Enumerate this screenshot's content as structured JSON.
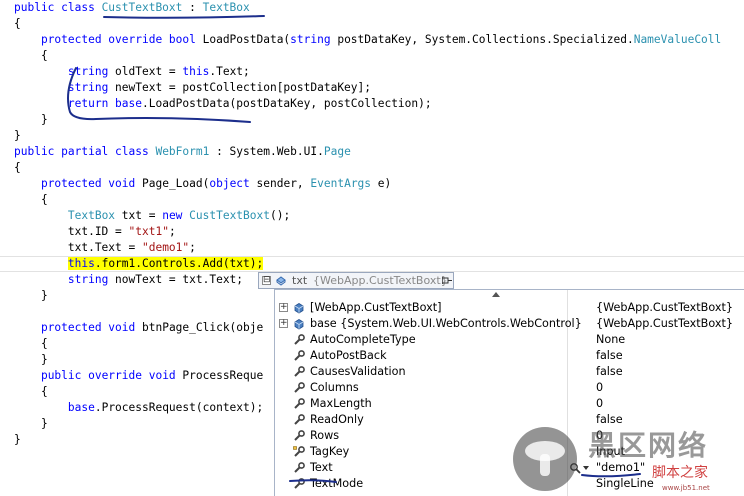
{
  "code": {
    "l1": [
      {
        "t": "public class ",
        "c": "kw"
      },
      {
        "t": "CustTextBoxt",
        "c": "ty"
      },
      {
        "t": " : ",
        "c": "pl"
      },
      {
        "t": "TextBox",
        "c": "ty"
      }
    ],
    "l2": [
      {
        "t": "{",
        "c": "pl"
      }
    ],
    "l3": [
      {
        "t": "    ",
        "c": "pl"
      },
      {
        "t": "protected override bool ",
        "c": "kw"
      },
      {
        "t": "LoadPostData(",
        "c": "pl"
      },
      {
        "t": "string ",
        "c": "kw"
      },
      {
        "t": "postDataKey, System.Collections.Specialized.",
        "c": "pl"
      },
      {
        "t": "NameValueColl",
        "c": "ty"
      }
    ],
    "l4": [
      {
        "t": "    {",
        "c": "pl"
      }
    ],
    "l5": [
      {
        "t": "        ",
        "c": "pl"
      },
      {
        "t": "string ",
        "c": "kw"
      },
      {
        "t": "oldText = ",
        "c": "pl"
      },
      {
        "t": "this",
        "c": "kw"
      },
      {
        "t": ".Text;",
        "c": "pl"
      }
    ],
    "l6": [
      {
        "t": "        ",
        "c": "pl"
      },
      {
        "t": "string ",
        "c": "kw"
      },
      {
        "t": "newText = postCollection[postDataKey];",
        "c": "pl"
      }
    ],
    "l7": [
      {
        "t": "        ",
        "c": "pl"
      },
      {
        "t": "return base",
        "c": "kw"
      },
      {
        "t": ".LoadPostData(postDataKey, postCollection);",
        "c": "pl"
      }
    ],
    "l8": [
      {
        "t": "    }",
        "c": "pl"
      }
    ],
    "l9": [
      {
        "t": "}",
        "c": "pl"
      }
    ],
    "l10": [
      {
        "t": "public partial class ",
        "c": "kw"
      },
      {
        "t": "WebForm1",
        "c": "ty"
      },
      {
        "t": " : System.Web.UI.",
        "c": "pl"
      },
      {
        "t": "Page",
        "c": "ty"
      }
    ],
    "l11": [
      {
        "t": "{",
        "c": "pl"
      }
    ],
    "l12": [
      {
        "t": "    ",
        "c": "pl"
      },
      {
        "t": "protected void ",
        "c": "kw"
      },
      {
        "t": "Page_Load(",
        "c": "pl"
      },
      {
        "t": "object ",
        "c": "kw"
      },
      {
        "t": "sender, ",
        "c": "pl"
      },
      {
        "t": "EventArgs",
        "c": "ty"
      },
      {
        "t": " e)",
        "c": "pl"
      }
    ],
    "l13": [
      {
        "t": "    {",
        "c": "pl"
      }
    ],
    "l14": [
      {
        "t": "        ",
        "c": "pl"
      },
      {
        "t": "TextBox",
        "c": "ty"
      },
      {
        "t": " txt = ",
        "c": "pl"
      },
      {
        "t": "new ",
        "c": "kw"
      },
      {
        "t": "CustTextBoxt",
        "c": "ty"
      },
      {
        "t": "();",
        "c": "pl"
      }
    ],
    "l15": [
      {
        "t": "        txt.ID = ",
        "c": "pl"
      },
      {
        "t": "\"txt1\"",
        "c": "st"
      },
      {
        "t": ";",
        "c": "pl"
      }
    ],
    "l16": [
      {
        "t": "        txt.Text = ",
        "c": "pl"
      },
      {
        "t": "\"demo1\"",
        "c": "st"
      },
      {
        "t": ";",
        "c": "pl"
      }
    ],
    "l17": [
      {
        "t": "        ",
        "c": "pl"
      },
      {
        "t": "this",
        "c": "kw hl-text"
      },
      {
        "t": ".form1.Controls.Add(txt);",
        "c": "pl hl-text"
      }
    ],
    "l18": [
      {
        "t": "        ",
        "c": "pl"
      },
      {
        "t": "string ",
        "c": "kw"
      },
      {
        "t": "nowText = txt.Text;",
        "c": "pl"
      }
    ],
    "l19": [
      {
        "t": "    }",
        "c": "pl"
      }
    ],
    "l20": [
      {
        "t": "",
        "c": "pl"
      }
    ],
    "l21": [
      {
        "t": "    ",
        "c": "pl"
      },
      {
        "t": "protected void ",
        "c": "kw"
      },
      {
        "t": "btnPage_Click(obje",
        "c": "pl"
      }
    ],
    "l22": [
      {
        "t": "    {",
        "c": "pl"
      }
    ],
    "l23": [
      {
        "t": "    }",
        "c": "pl"
      }
    ],
    "l24": [
      {
        "t": "    ",
        "c": "pl"
      },
      {
        "t": "public override void ",
        "c": "kw"
      },
      {
        "t": "ProcessReque",
        "c": "pl"
      }
    ],
    "l25": [
      {
        "t": "    {",
        "c": "pl"
      }
    ],
    "l26": [
      {
        "t": "        ",
        "c": "pl"
      },
      {
        "t": "base",
        "c": "kw"
      },
      {
        "t": ".ProcessRequest(context);",
        "c": "pl"
      }
    ],
    "l27": [
      {
        "t": "    }",
        "c": "pl"
      }
    ],
    "l28": [
      {
        "t": "}",
        "c": "pl"
      }
    ]
  },
  "datatip": {
    "expander": "⊟",
    "name": "txt",
    "value": "{WebApp.CustTextBoxt}"
  },
  "properties": [
    {
      "name": "[WebApp.CustTextBoxt]",
      "value": "{WebApp.CustTextBoxt}",
      "expandable": true,
      "icon": "class-icon"
    },
    {
      "name": "base {System.Web.UI.WebControls.WebControl}",
      "value": "{WebApp.CustTextBoxt}",
      "expandable": true,
      "icon": "class-icon"
    },
    {
      "name": "AutoCompleteType",
      "value": "None",
      "expandable": false,
      "icon": "property-icon"
    },
    {
      "name": "AutoPostBack",
      "value": "false",
      "expandable": false,
      "icon": "property-icon"
    },
    {
      "name": "CausesValidation",
      "value": "false",
      "expandable": false,
      "icon": "property-icon"
    },
    {
      "name": "Columns",
      "value": "0",
      "expandable": false,
      "icon": "property-icon"
    },
    {
      "name": "MaxLength",
      "value": "0",
      "expandable": false,
      "icon": "property-icon"
    },
    {
      "name": "ReadOnly",
      "value": "false",
      "expandable": false,
      "icon": "property-icon"
    },
    {
      "name": "Rows",
      "value": "0",
      "expandable": false,
      "icon": "property-icon"
    },
    {
      "name": "TagKey",
      "value": "Input",
      "expandable": false,
      "icon": "protected-property-icon"
    },
    {
      "name": "Text",
      "value": "\"demo1\"",
      "expandable": false,
      "icon": "property-icon",
      "magnifier": true
    },
    {
      "name": "TextMode",
      "value": "SingleLine",
      "expandable": false,
      "icon": "property-icon"
    }
  ],
  "watermark": {
    "title": "黑区网络",
    "subtitle": "脚本之家",
    "url": "www.jb51.net"
  },
  "colors": {
    "keyword": "#0000ff",
    "type": "#2b91af",
    "string": "#a31515",
    "highlight": "#ffff00",
    "annotation_ink": "#1c2e8c"
  }
}
